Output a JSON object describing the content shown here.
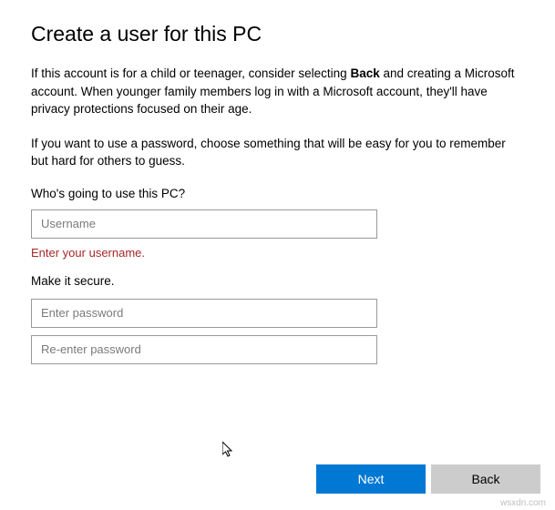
{
  "title": "Create a user for this PC",
  "description1_pre": "If this account is for a child or teenager, consider selecting ",
  "description1_bold": "Back",
  "description1_post": " and creating a Microsoft account. When younger family members log in with a Microsoft account, they'll have privacy protections focused on their age.",
  "description2": "If you want to use a password, choose something that will be easy for you to remember but hard for others to guess.",
  "username_section_label": "Who's going to use this PC?",
  "username_placeholder": "Username",
  "username_error": "Enter your username.",
  "password_section_label": "Make it secure.",
  "password_placeholder": "Enter password",
  "password_confirm_placeholder": "Re-enter password",
  "buttons": {
    "next": "Next",
    "back": "Back"
  },
  "watermark": "wsxdn.com"
}
